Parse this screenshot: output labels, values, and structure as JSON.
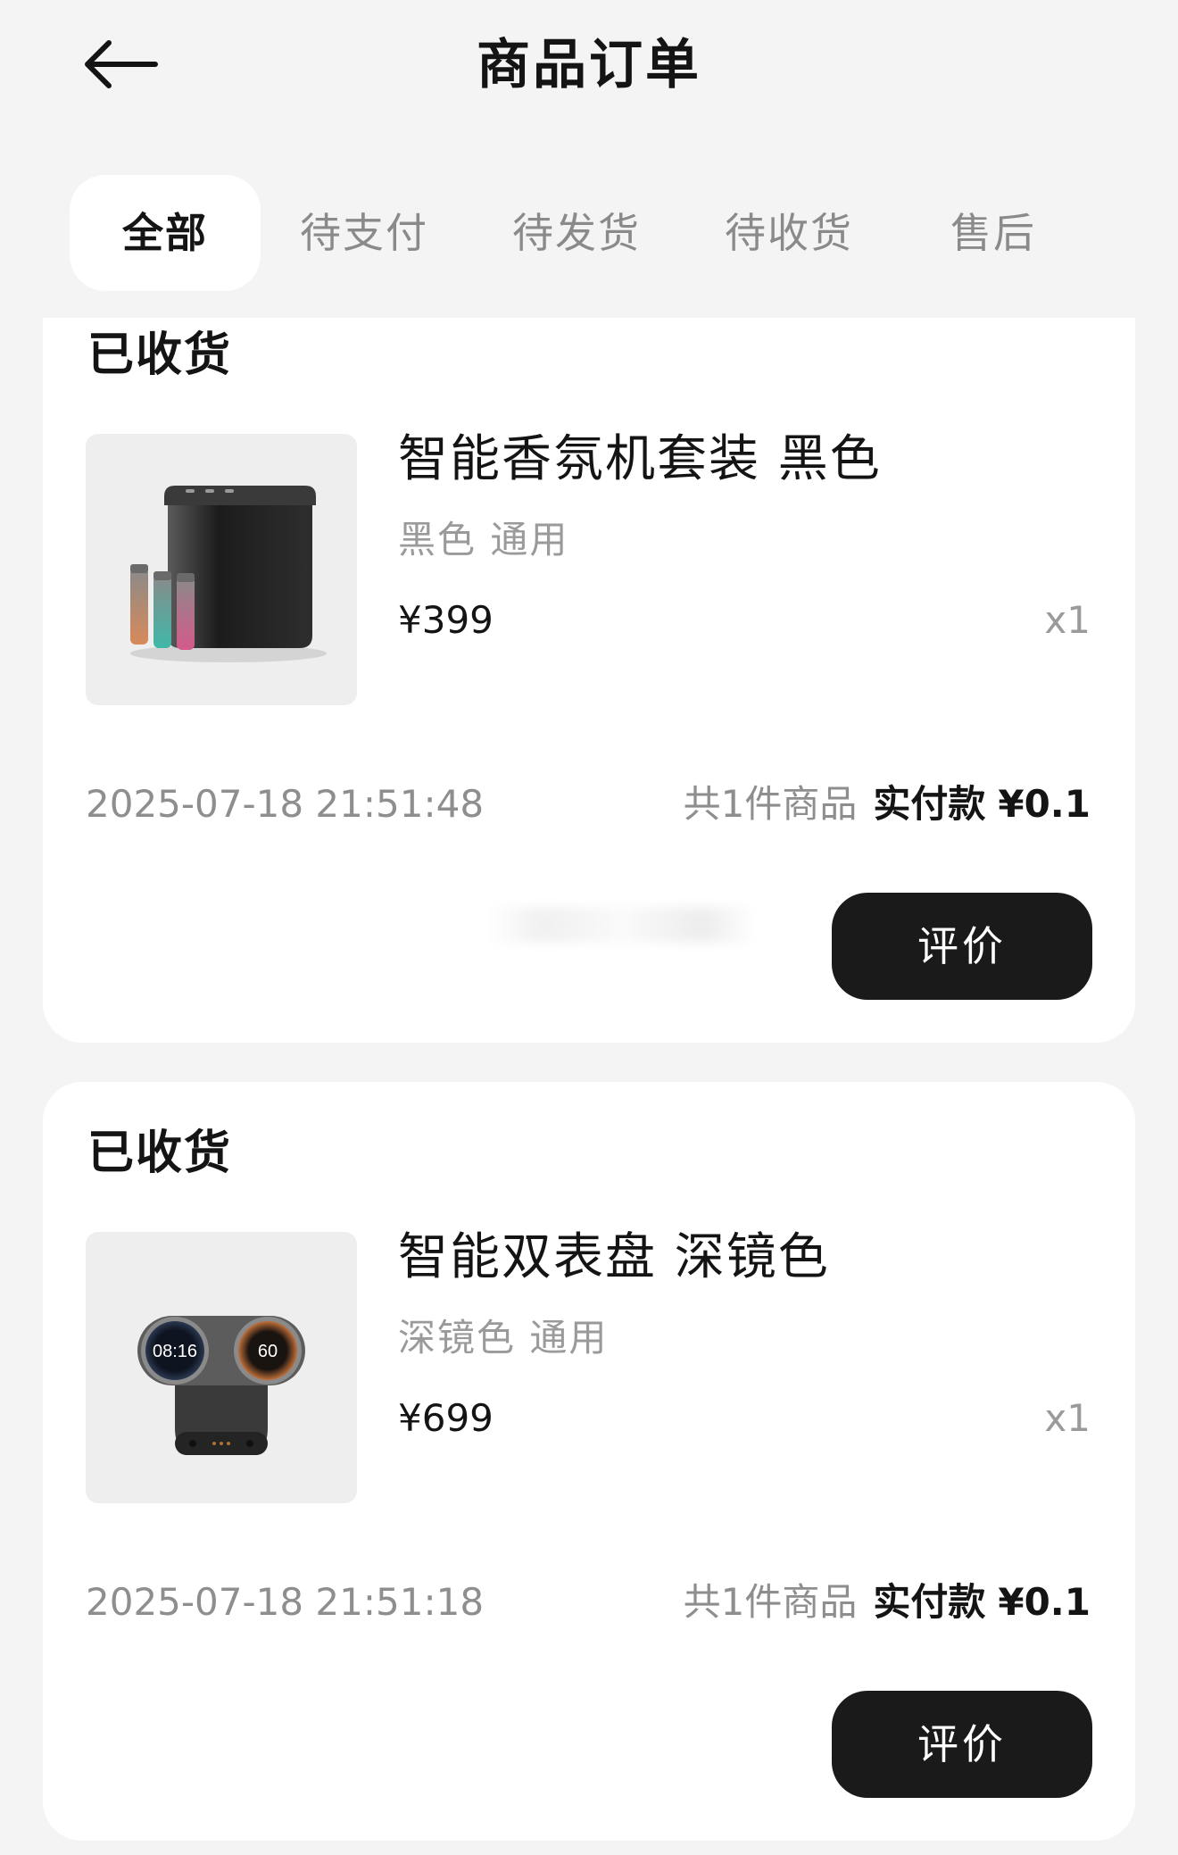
{
  "header": {
    "title": "商品订单",
    "back_icon": "arrow-left-icon"
  },
  "tabs": [
    {
      "label": "全部",
      "active": true
    },
    {
      "label": "待支付",
      "active": false
    },
    {
      "label": "待发货",
      "active": false
    },
    {
      "label": "待收货",
      "active": false
    },
    {
      "label": "售后",
      "active": false
    }
  ],
  "orders": [
    {
      "status": "已收货",
      "product": {
        "name": "智能香氛机套装 黑色",
        "spec": "黑色 通用",
        "price": "¥399",
        "quantity": "x1",
        "image": "aroma-diffuser-set-image"
      },
      "time": "2025-07-18 21:51:48",
      "item_count": "共1件商品",
      "paid_label": "实付款",
      "paid_amount": "¥0.1",
      "action_label": "评价"
    },
    {
      "status": "已收货",
      "product": {
        "name": "智能双表盘 深镜色",
        "spec": "深镜色 通用",
        "price": "¥699",
        "quantity": "x1",
        "image": "dual-dial-display-image",
        "dial_left_text": "08:16",
        "dial_right_text": "60"
      },
      "time": "2025-07-18 21:51:18",
      "item_count": "共1件商品",
      "paid_label": "实付款",
      "paid_amount": "¥0.1",
      "action_label": "评价"
    }
  ],
  "colors": {
    "background": "#f4f4f4",
    "card": "#ffffff",
    "button": "#1a1a1a",
    "muted_text": "#8e8e8e"
  }
}
